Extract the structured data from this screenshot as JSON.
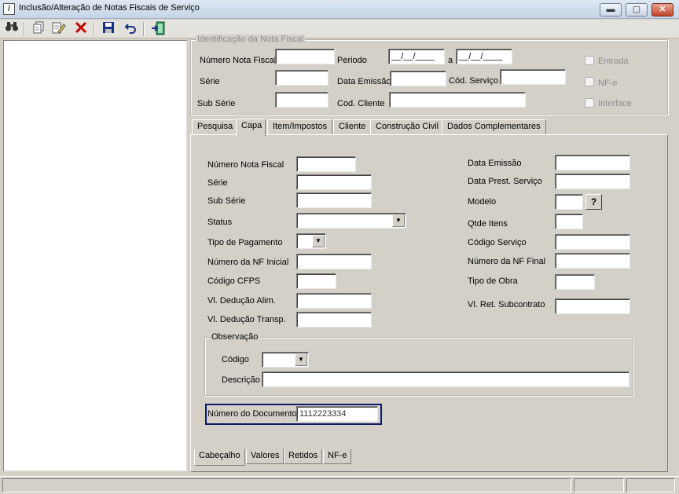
{
  "window": {
    "title": "Inclusão/Alteração de Notas Fiscais de Serviço"
  },
  "icons": [
    "binoculars-icon",
    "copy-icon",
    "edit-icon",
    "delete-icon",
    "save-icon",
    "undo-icon",
    "exit-icon"
  ],
  "colors": {
    "delete_icon": "#cc0000",
    "highlight_border": "#0b1a6b",
    "titlebar": "#c5d4e6"
  },
  "ident": {
    "title": "Identificação da Nota Fiscal",
    "numero_nf": "Número Nota Fiscal",
    "periodo": "Periodo",
    "periodo_ini": "__/__/____",
    "periodo_a": "a",
    "periodo_fim": "__/__/____",
    "serie": "Série",
    "data_emissao": "Data Emissão",
    "cod_servico": "Cód. Serviço",
    "sub_serie": "Sub Série",
    "cod_cliente": "Cod. Cliente",
    "entrada": "Entrada",
    "nfe": "NF-e",
    "interface": "Interface"
  },
  "tabs": [
    "Pesquisa",
    "Capa",
    "Item/Impostos",
    "Cliente",
    "Construção Civil",
    "Dados Complementares"
  ],
  "capa": {
    "numero_nf": "Número Nota Fiscal",
    "serie": "Série",
    "sub_serie": "Sub Série",
    "status": "Status",
    "tipo_pagamento": "Tipo de Pagamento",
    "nf_inicial": "Número da NF Inicial",
    "cfps": "Código CFPS",
    "ded_alim": "Vl. Dedução Alim.",
    "ded_transp": "Vl. Dedução Transp.",
    "data_emissao": "Data Emissão",
    "data_prest": "Data Prest. Serviço",
    "modelo": "Modelo",
    "modelo_btn": "?",
    "qtde_itens": "Qtde Itens",
    "cod_servico": "Código Serviço",
    "nf_final": "Número da NF Final",
    "tipo_obra": "Tipo de Obra",
    "ret_subcontrato": "Vl. Ret. Subcontrato",
    "obs_title": "Observação",
    "obs_codigo": "Código",
    "obs_descricao": "Descrição",
    "num_documento": "Número do Documento",
    "num_documento_value": "1112223334"
  },
  "bottom_tabs": [
    "Cabeçalho",
    "Valores",
    "Retidos",
    "NF-e"
  ]
}
